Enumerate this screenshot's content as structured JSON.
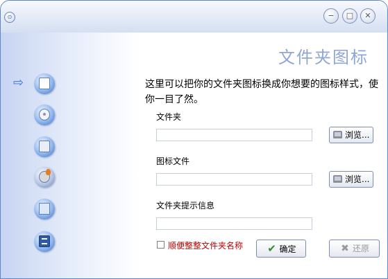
{
  "window": {
    "menu_glyph": "⊙",
    "controls": {
      "minimize": "−",
      "maximize": "□",
      "close": "✕"
    }
  },
  "sidebar": {
    "current_marker": "⇨",
    "items": [
      {
        "icon": "folder-icon"
      },
      {
        "icon": "disc-icon"
      },
      {
        "icon": "package-icon"
      },
      {
        "icon": "burn-disc-icon"
      },
      {
        "icon": "monitor-icon"
      },
      {
        "icon": "notepad-icon"
      }
    ]
  },
  "main": {
    "title": "文件夹图标",
    "description": "这里可以把你的文件夹图标换成你想要的图标样式，使你一目了然。",
    "folder_label": "文件夹",
    "folder_value": "",
    "icon_file_label": "图标文件",
    "icon_file_value": "",
    "tip_label": "文件夹提示信息",
    "tip_value": "",
    "browse_label": "浏览...",
    "rename_checkbox_label": "顺便整整文件夹名称",
    "rename_checked": false,
    "ok_label": "确定",
    "ok_icon": "✔",
    "restore_label": "还原",
    "restore_icon": "✖"
  },
  "colors": {
    "accent": "#5f84c8",
    "title_text": "#8fa6d6",
    "checkbox_label": "#c00000"
  }
}
